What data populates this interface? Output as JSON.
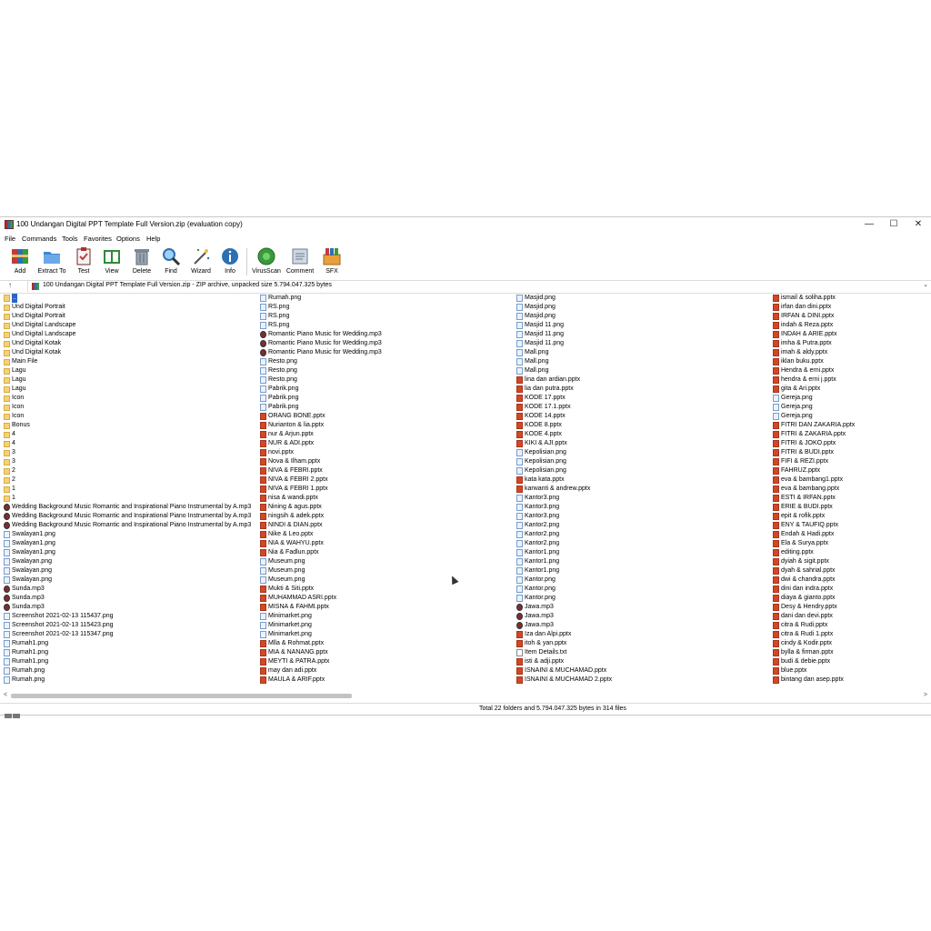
{
  "window": {
    "title": "100 Undangan Digital PPT Template Full Version.zip (evaluation copy)",
    "controls": {
      "minimize": "—",
      "maximize": "☐",
      "close": "✕"
    }
  },
  "menu": [
    "File",
    "Commands",
    "Tools",
    "Favorites",
    "Options",
    "Help"
  ],
  "toolbar": [
    {
      "label": "Add",
      "icon": "add-archive-icon"
    },
    {
      "label": "Extract To",
      "icon": "extract-folder-icon"
    },
    {
      "label": "Test",
      "icon": "test-clipboard-icon"
    },
    {
      "label": "View",
      "icon": "view-book-icon"
    },
    {
      "label": "Delete",
      "icon": "delete-trash-icon"
    },
    {
      "label": "Find",
      "icon": "find-magnifier-icon"
    },
    {
      "label": "Wizard",
      "icon": "wizard-wand-icon"
    },
    {
      "label": "Info",
      "icon": "info-icon"
    },
    {
      "label": "VirusScan",
      "icon": "virusscan-icon"
    },
    {
      "label": "Comment",
      "icon": "comment-icon"
    },
    {
      "label": "SFX",
      "icon": "sfx-icon"
    }
  ],
  "address": {
    "text": "100 Undangan Digital PPT Template Full Version.zip - ZIP archive, unpacked size 5.794.047.325 bytes"
  },
  "files": {
    "col1": [
      {
        "name": "..",
        "type": "up"
      },
      {
        "name": "Und Digital Portrait",
        "type": "folder"
      },
      {
        "name": "Und Digital Portrait",
        "type": "folder"
      },
      {
        "name": "Und Digital Landscape",
        "type": "folder"
      },
      {
        "name": "Und Digital Landscape",
        "type": "folder"
      },
      {
        "name": "Und Digital Kotak",
        "type": "folder"
      },
      {
        "name": "Und Digital Kotak",
        "type": "folder"
      },
      {
        "name": "Main File",
        "type": "folder"
      },
      {
        "name": "Lagu",
        "type": "folder"
      },
      {
        "name": "Lagu",
        "type": "folder"
      },
      {
        "name": "Lagu",
        "type": "folder"
      },
      {
        "name": "Icon",
        "type": "folder"
      },
      {
        "name": "Icon",
        "type": "folder"
      },
      {
        "name": "Icon",
        "type": "folder"
      },
      {
        "name": "Bonus",
        "type": "folder"
      },
      {
        "name": "4",
        "type": "folder"
      },
      {
        "name": "4",
        "type": "folder"
      },
      {
        "name": "3",
        "type": "folder"
      },
      {
        "name": "3",
        "type": "folder"
      },
      {
        "name": "2",
        "type": "folder"
      },
      {
        "name": "2",
        "type": "folder"
      },
      {
        "name": "1",
        "type": "folder"
      },
      {
        "name": "1",
        "type": "folder"
      },
      {
        "name": "Wedding Background Music Romantic and Inspirational Piano Instrumental by A.mp3",
        "type": "mp3"
      },
      {
        "name": "Wedding Background Music Romantic and Inspirational Piano Instrumental by A.mp3",
        "type": "mp3"
      },
      {
        "name": "Wedding Background Music Romantic and Inspirational Piano Instrumental by A.mp3",
        "type": "mp3"
      },
      {
        "name": "Swalayan1.png",
        "type": "png"
      },
      {
        "name": "Swalayan1.png",
        "type": "png"
      },
      {
        "name": "Swalayan1.png",
        "type": "png"
      },
      {
        "name": "Swalayan.png",
        "type": "png"
      },
      {
        "name": "Swalayan.png",
        "type": "png"
      },
      {
        "name": "Swalayan.png",
        "type": "png"
      },
      {
        "name": "Sunda.mp3",
        "type": "mp3"
      },
      {
        "name": "Sunda.mp3",
        "type": "mp3"
      },
      {
        "name": "Sunda.mp3",
        "type": "mp3"
      },
      {
        "name": "Screenshot 2021-02-13 115437.png",
        "type": "png"
      },
      {
        "name": "Screenshot 2021-02-13 115423.png",
        "type": "png"
      },
      {
        "name": "Screenshot 2021-02-13 115347.png",
        "type": "png"
      },
      {
        "name": "Rumah1.png",
        "type": "png"
      },
      {
        "name": "Rumah1.png",
        "type": "png"
      },
      {
        "name": "Rumah1.png",
        "type": "png"
      },
      {
        "name": "Rumah.png",
        "type": "png"
      },
      {
        "name": "Rumah.png",
        "type": "png"
      }
    ],
    "col2": [
      {
        "name": "Rumah.png",
        "type": "png"
      },
      {
        "name": "RS.png",
        "type": "png"
      },
      {
        "name": "RS.png",
        "type": "png"
      },
      {
        "name": "RS.png",
        "type": "png"
      },
      {
        "name": "Romantic Piano Music for Wedding.mp3",
        "type": "mp3"
      },
      {
        "name": "Romantic Piano Music for Wedding.mp3",
        "type": "mp3"
      },
      {
        "name": "Romantic Piano Music for Wedding.mp3",
        "type": "mp3"
      },
      {
        "name": "Resto.png",
        "type": "png"
      },
      {
        "name": "Resto.png",
        "type": "png"
      },
      {
        "name": "Resto.png",
        "type": "png"
      },
      {
        "name": "Pabrik.png",
        "type": "png"
      },
      {
        "name": "Pabrik.png",
        "type": "png"
      },
      {
        "name": "Pabrik.png",
        "type": "png"
      },
      {
        "name": "ORANG BONE.pptx",
        "type": "pptx"
      },
      {
        "name": "Nurianton & lia.pptx",
        "type": "pptx"
      },
      {
        "name": "nur & Arjun.pptx",
        "type": "pptx"
      },
      {
        "name": "NUR & ADI.pptx",
        "type": "pptx"
      },
      {
        "name": "novi.pptx",
        "type": "pptx"
      },
      {
        "name": "Nova & Ilham.pptx",
        "type": "pptx"
      },
      {
        "name": "NIVA & FEBRI.pptx",
        "type": "pptx"
      },
      {
        "name": "NIVA & FEBRI 2.pptx",
        "type": "pptx"
      },
      {
        "name": "NIVA & FEBRI 1.pptx",
        "type": "pptx"
      },
      {
        "name": "nisa & wandi.pptx",
        "type": "pptx"
      },
      {
        "name": "Nining & agus.pptx",
        "type": "pptx"
      },
      {
        "name": "ningsih & adek.pptx",
        "type": "pptx"
      },
      {
        "name": "NINDI & DIAN.pptx",
        "type": "pptx"
      },
      {
        "name": "Nike & Leo.pptx",
        "type": "pptx"
      },
      {
        "name": "NIA & WAHYU.pptx",
        "type": "pptx"
      },
      {
        "name": "Nia & Fadlun.pptx",
        "type": "pptx"
      },
      {
        "name": "Museum.png",
        "type": "png"
      },
      {
        "name": "Museum.png",
        "type": "png"
      },
      {
        "name": "Museum.png",
        "type": "png"
      },
      {
        "name": "Mukti & Siti.pptx",
        "type": "pptx"
      },
      {
        "name": "MUHAMMAD ASRI.pptx",
        "type": "pptx"
      },
      {
        "name": "MISNA & FAHMI.pptx",
        "type": "pptx"
      },
      {
        "name": "Minimarket.png",
        "type": "png"
      },
      {
        "name": "Minimarket.png",
        "type": "png"
      },
      {
        "name": "Minimarket.png",
        "type": "png"
      },
      {
        "name": "Mlla & Rohmat.pptx",
        "type": "pptx"
      },
      {
        "name": "MIA & NANANG.pptx",
        "type": "pptx"
      },
      {
        "name": "MEYTI & PATRA.pptx",
        "type": "pptx"
      },
      {
        "name": "may dan adi.pptx",
        "type": "pptx"
      },
      {
        "name": "MAULA & ARIF.pptx",
        "type": "pptx"
      }
    ],
    "col3": [
      {
        "name": "Masjid.png",
        "type": "png"
      },
      {
        "name": "Masjid.png",
        "type": "png"
      },
      {
        "name": "Masjid.png",
        "type": "png"
      },
      {
        "name": "Masjid 11.png",
        "type": "png"
      },
      {
        "name": "Masjid 11.png",
        "type": "png"
      },
      {
        "name": "Masjid 11.png",
        "type": "png"
      },
      {
        "name": "Mall.png",
        "type": "png"
      },
      {
        "name": "Mall.png",
        "type": "png"
      },
      {
        "name": "Mall.png",
        "type": "png"
      },
      {
        "name": "lina dan ardian.pptx",
        "type": "pptx"
      },
      {
        "name": "lia dan putra.pptx",
        "type": "pptx"
      },
      {
        "name": "KODE 17.pptx",
        "type": "pptx"
      },
      {
        "name": "KODE 17.1.pptx",
        "type": "pptx"
      },
      {
        "name": "KODE 14.pptx",
        "type": "pptx"
      },
      {
        "name": "KODE 8.pptx",
        "type": "pptx"
      },
      {
        "name": "KODE 4.pptx",
        "type": "pptx"
      },
      {
        "name": "KIKI & AJI.pptx",
        "type": "pptx"
      },
      {
        "name": "Kepolisian.png",
        "type": "png"
      },
      {
        "name": "Kepolisian.png",
        "type": "png"
      },
      {
        "name": "Kepolisian.png",
        "type": "png"
      },
      {
        "name": "kata kata.pptx",
        "type": "pptx"
      },
      {
        "name": "karwanti & andrew.pptx",
        "type": "pptx"
      },
      {
        "name": "Kantor3.png",
        "type": "png"
      },
      {
        "name": "Kantor3.png",
        "type": "png"
      },
      {
        "name": "Kantor3.png",
        "type": "png"
      },
      {
        "name": "Kantor2.png",
        "type": "png"
      },
      {
        "name": "Kantor2.png",
        "type": "png"
      },
      {
        "name": "Kantor2.png",
        "type": "png"
      },
      {
        "name": "Kantor1.png",
        "type": "png"
      },
      {
        "name": "Kantor1.png",
        "type": "png"
      },
      {
        "name": "Kantor1.png",
        "type": "png"
      },
      {
        "name": "Kantor.png",
        "type": "png"
      },
      {
        "name": "Kantor.png",
        "type": "png"
      },
      {
        "name": "Kantor.png",
        "type": "png"
      },
      {
        "name": "Jawa.mp3",
        "type": "mp3"
      },
      {
        "name": "Jawa.mp3",
        "type": "mp3"
      },
      {
        "name": "Jawa.mp3",
        "type": "mp3"
      },
      {
        "name": "Iza dan Alpi.pptx",
        "type": "pptx"
      },
      {
        "name": "itoh & yan.pptx",
        "type": "pptx"
      },
      {
        "name": "Item Details.txt",
        "type": "txt"
      },
      {
        "name": "isti & adji.pptx",
        "type": "pptx"
      },
      {
        "name": "ISNAINI & MUCHAMAD.pptx",
        "type": "pptx"
      },
      {
        "name": "ISNAINI & MUCHAMAD 2.pptx",
        "type": "pptx"
      }
    ],
    "col4": [
      {
        "name": "ismail & soliha.pptx",
        "type": "pptx"
      },
      {
        "name": "irfan dan dini.pptx",
        "type": "pptx"
      },
      {
        "name": "IRFAN & DINI.pptx",
        "type": "pptx"
      },
      {
        "name": "indah & Reza.pptx",
        "type": "pptx"
      },
      {
        "name": "INDAH & ARIE.pptx",
        "type": "pptx"
      },
      {
        "name": "imha & Putra.pptx",
        "type": "pptx"
      },
      {
        "name": "imah & aldy.pptx",
        "type": "pptx"
      },
      {
        "name": "iklan buku.pptx",
        "type": "pptx"
      },
      {
        "name": "Hendra & erni.pptx",
        "type": "pptx"
      },
      {
        "name": "hendra & erni j.pptx",
        "type": "pptx"
      },
      {
        "name": "gita & Ari.pptx",
        "type": "pptx"
      },
      {
        "name": "Gereja.png",
        "type": "png"
      },
      {
        "name": "Gereja.png",
        "type": "png"
      },
      {
        "name": "Gereja.png",
        "type": "png"
      },
      {
        "name": "FITRI DAN ZAKARIA.pptx",
        "type": "pptx"
      },
      {
        "name": "FITRI & ZAKARIA.pptx",
        "type": "pptx"
      },
      {
        "name": "FITRI & JOKO.pptx",
        "type": "pptx"
      },
      {
        "name": "FITRI & BUDI.pptx",
        "type": "pptx"
      },
      {
        "name": "FIFI & REZI.pptx",
        "type": "pptx"
      },
      {
        "name": "FAHRUZ.pptx",
        "type": "pptx"
      },
      {
        "name": "eva & bambang1.pptx",
        "type": "pptx"
      },
      {
        "name": "eva & bambang.pptx",
        "type": "pptx"
      },
      {
        "name": "ESTI & IRFAN.pptx",
        "type": "pptx"
      },
      {
        "name": "ERIE & BUDI.pptx",
        "type": "pptx"
      },
      {
        "name": "epit & rofik.pptx",
        "type": "pptx"
      },
      {
        "name": "ENY & TAUFIQ.pptx",
        "type": "pptx"
      },
      {
        "name": "Endah & Hadi.pptx",
        "type": "pptx"
      },
      {
        "name": "Ela & Surya.pptx",
        "type": "pptx"
      },
      {
        "name": "editing.pptx",
        "type": "pptx"
      },
      {
        "name": "dyiah & sigit.pptx",
        "type": "pptx"
      },
      {
        "name": "dyah & sahrial.pptx",
        "type": "pptx"
      },
      {
        "name": "dwi & chandra.pptx",
        "type": "pptx"
      },
      {
        "name": "dini dan indra.pptx",
        "type": "pptx"
      },
      {
        "name": "diaya & gianto.pptx",
        "type": "pptx"
      },
      {
        "name": "Desy & Hendry.pptx",
        "type": "pptx"
      },
      {
        "name": "dani dan devi.pptx",
        "type": "pptx"
      },
      {
        "name": "citra & Rudi.pptx",
        "type": "pptx"
      },
      {
        "name": "citra & Rudi 1.pptx",
        "type": "pptx"
      },
      {
        "name": "cindy & Kodir.pptx",
        "type": "pptx"
      },
      {
        "name": "bylla & firman.pptx",
        "type": "pptx"
      },
      {
        "name": "budi & debie.pptx",
        "type": "pptx"
      },
      {
        "name": "blue.pptx",
        "type": "pptx"
      },
      {
        "name": "bintang dan asep.pptx",
        "type": "pptx"
      }
    ]
  },
  "scrollbar": {
    "left": "<",
    "right": ">"
  },
  "status": {
    "text": "Total 22 folders and 5.794.047.325 bytes in 314 files"
  }
}
